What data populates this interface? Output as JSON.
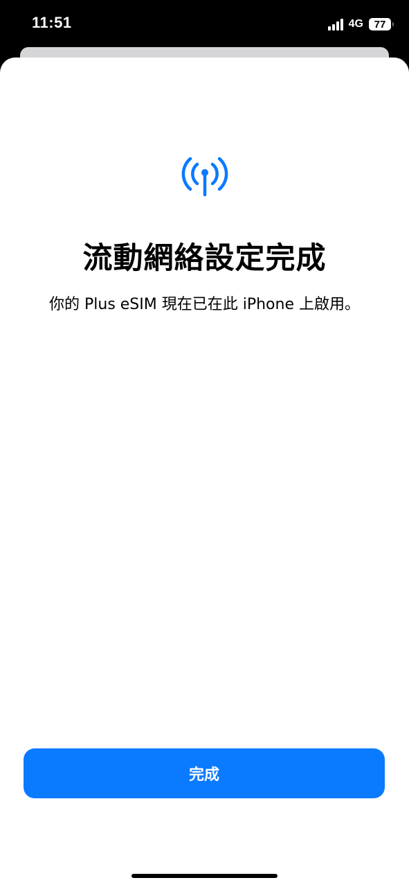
{
  "status_bar": {
    "time": "11:51",
    "network": "4G",
    "battery_level": "77",
    "icons": [
      "signal-bars-icon",
      "battery-icon"
    ]
  },
  "main": {
    "icon": "cellular-antenna-icon",
    "title": "流動網絡設定完成",
    "subtitle": "你的 Plus eSIM 現在已在此 iPhone 上啟用。"
  },
  "actions": {
    "done_label": "完成"
  },
  "colors": {
    "accent": "#0a7aff",
    "background": "#ffffff",
    "status_bar_bg": "#000000"
  }
}
